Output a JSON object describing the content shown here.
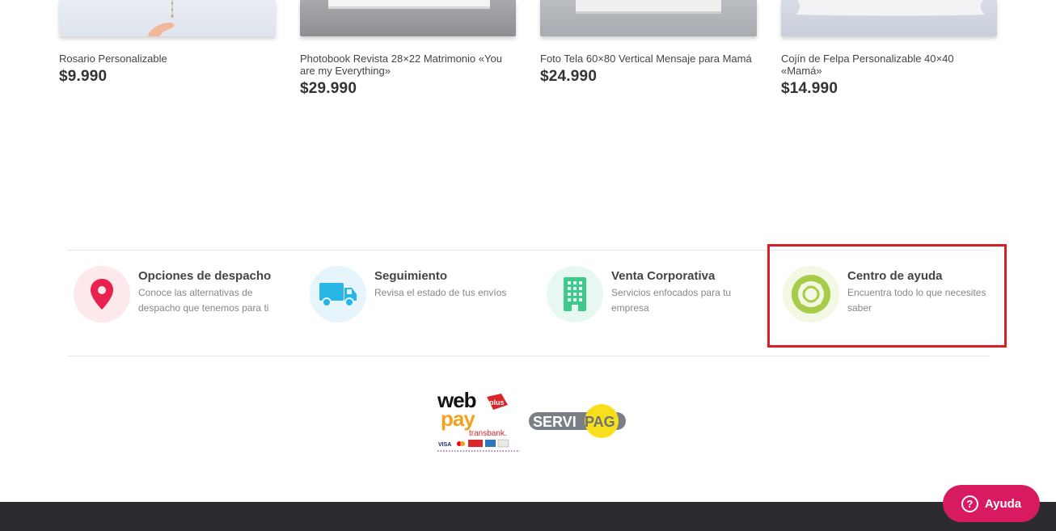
{
  "products": [
    {
      "name": "Rosario Personalizable",
      "price": "$9.990"
    },
    {
      "name": "Photobook Revista 28×22 Matrimonio «You are my Everything»",
      "price": "$29.990"
    },
    {
      "name": "Foto Tela 60×80 Vertical Mensaje para Mamá",
      "price": "$24.990"
    },
    {
      "name": "Cojín de Felpa Personalizable 40×40 «Mamá»",
      "price": "$14.990"
    }
  ],
  "services": [
    {
      "title": "Opciones de despacho",
      "desc": "Conoce las alternativas de despacho que tenemos para ti",
      "icon": "location-pin-icon",
      "color": "#e8224f",
      "bg": "#fde8ec"
    },
    {
      "title": "Seguimiento",
      "desc": "Revisa el estado de tus envíos",
      "icon": "truck-icon",
      "color": "#29b6e6",
      "bg": "#e6f5fb"
    },
    {
      "title": "Venta Corporativa",
      "desc": "Servicios enfocados para tu empresa",
      "icon": "building-icon",
      "color": "#3fc98f",
      "bg": "#e6f8f0"
    },
    {
      "title": "Centro de ayuda",
      "desc": "Encuentra todo lo que necesites saber",
      "icon": "lifebuoy-icon",
      "color": "#a6cc4a",
      "bg": "#f2f8e3"
    }
  ],
  "payments": {
    "webpay": {
      "word1": "web",
      "word2": "pay",
      "badge": "plus",
      "brand": "transbank.",
      "cards": [
        "VISA"
      ]
    },
    "servipag": {
      "part1": "SERVI",
      "part2": "PAG"
    }
  },
  "help_button": {
    "label": "Ayuda",
    "glyph": "?"
  },
  "colors": {
    "accent": "#d81b60",
    "highlight": "#d81f26",
    "footer": "#2c2c30"
  }
}
